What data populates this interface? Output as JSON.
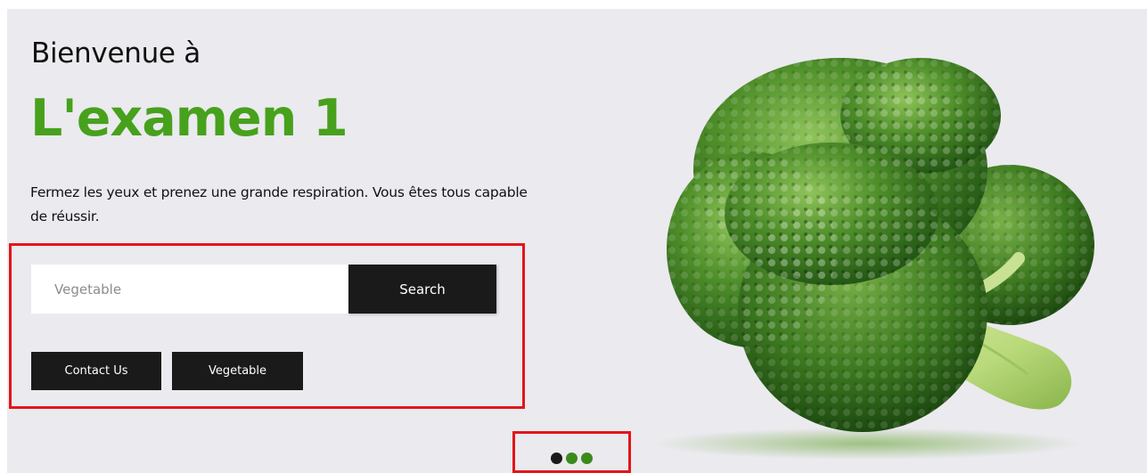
{
  "hero": {
    "welcome": "Bienvenue à",
    "title": "L'examen 1",
    "subtitle": "Fermez les yeux et prenez une grande respiration. Vous êtes tous capable de réussir.",
    "accent_color": "#47a11c",
    "background_color": "#ebeaef"
  },
  "search": {
    "placeholder": "Vegetable",
    "value": "",
    "button_label": "Search"
  },
  "actions": {
    "contact_label": "Contact Us",
    "vegetable_label": "Vegetable"
  },
  "carousel": {
    "slide_count": 3,
    "active_index": 0,
    "active_color": "#1a1a1a",
    "inactive_color": "#3a8a1c"
  },
  "image": {
    "icon": "broccoli-image"
  }
}
